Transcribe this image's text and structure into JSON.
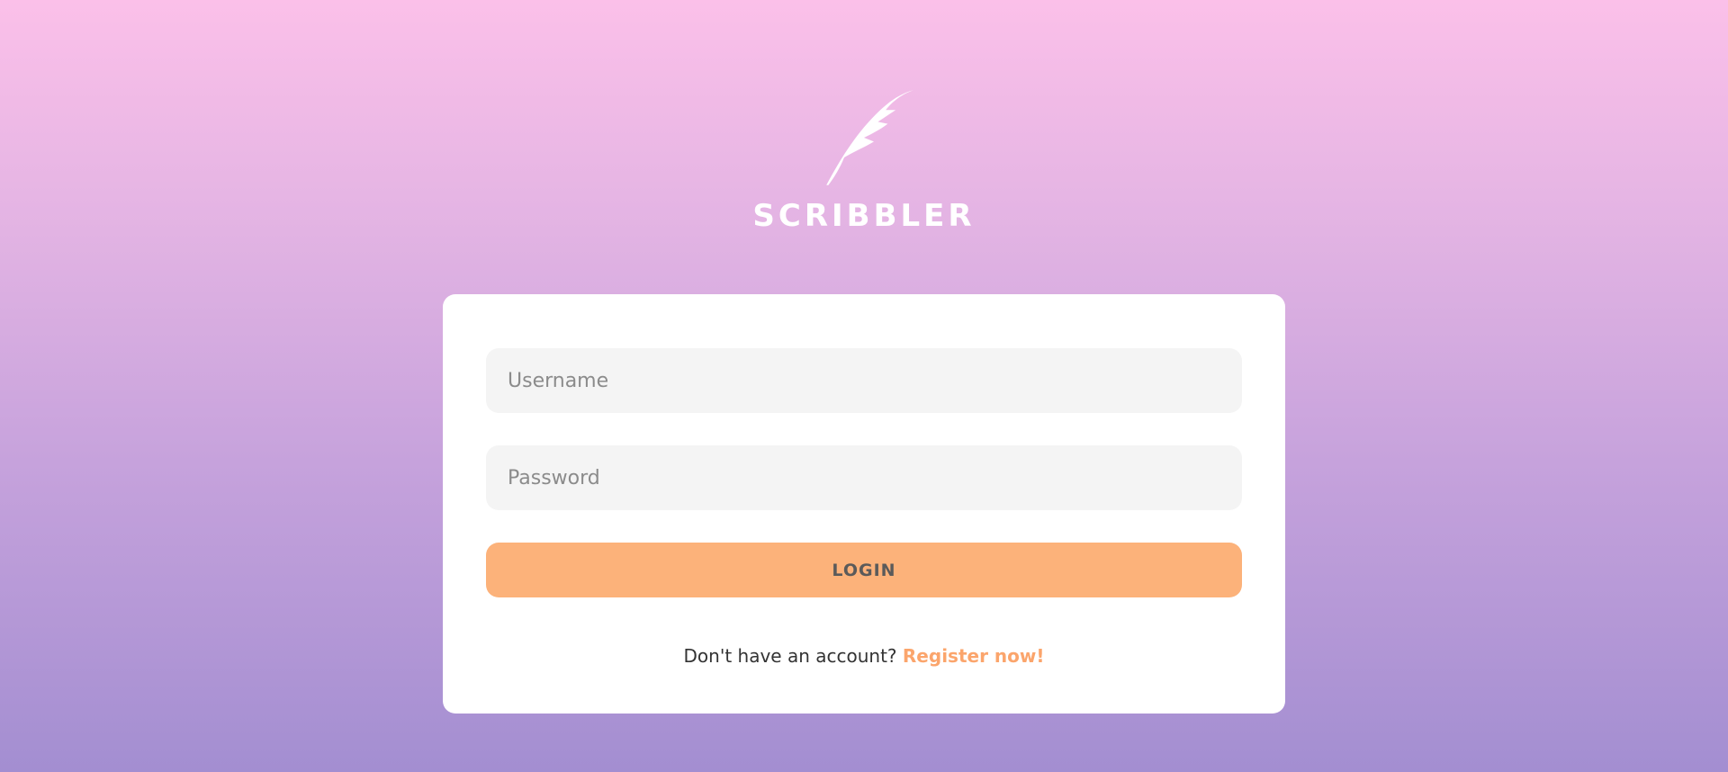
{
  "brand": {
    "name": "SCRIBBLER",
    "logo_icon": "feather-quill-icon"
  },
  "login_form": {
    "username_placeholder": "Username",
    "password_placeholder": "Password",
    "login_label": "LOGIN",
    "footer_prompt": "Don't have an account?",
    "register_link": "Register now!"
  },
  "colors": {
    "accent": "#fcb27a",
    "link": "#fba56c",
    "gradient_top": "#fbc0e9",
    "gradient_bottom": "#a38ed1"
  }
}
